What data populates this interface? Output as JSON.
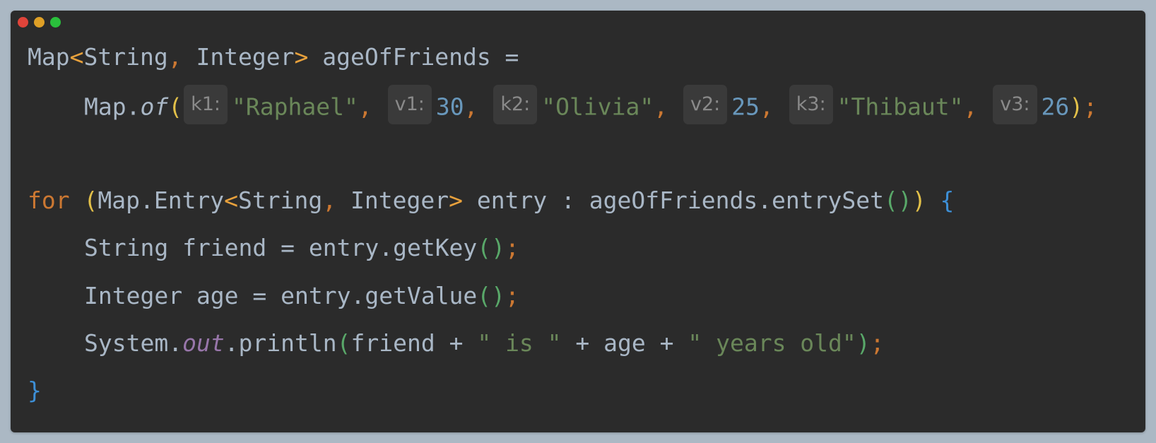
{
  "window": {
    "controls": [
      {
        "name": "close",
        "color": "#e0443a"
      },
      {
        "name": "minimize",
        "color": "#dfa026"
      },
      {
        "name": "maximize",
        "color": "#2ac03c"
      }
    ]
  },
  "code": {
    "line1": {
      "t1": "Map",
      "t2": "<",
      "t3": "String",
      "t4": ",",
      "t5": " Integer",
      "t6": ">",
      "t7": " ageOfFriends ="
    },
    "line2": {
      "t1": "Map.",
      "t2": "of",
      "t3": "(",
      "h1": "k1:",
      "s1": "\"Raphael\"",
      "c1": ", ",
      "h2": "v1:",
      "n1": "30",
      "c2": ", ",
      "h3": "k2:",
      "s2": "\"Olivia\"",
      "c3": ", ",
      "h4": "v2:",
      "n2": "25",
      "c4": ", ",
      "h5": "k3:",
      "s3": "\"Thibaut\"",
      "c5": ", ",
      "h6": "v3:",
      "n3": "26",
      "t4": ")",
      "t5": ";"
    },
    "line3": {
      "t1": "for",
      "t2": " ",
      "t3": "(",
      "t4": "Map.Entry",
      "t5": "<",
      "t6": "String",
      "t7": ",",
      "t8": " Integer",
      "t9": ">",
      "t10": " entry : ageOfFriends.entrySet",
      "t11": "()",
      "t12": ")",
      "t13": " ",
      "t14": "{"
    },
    "line4": {
      "t1": "String friend = entry.getKey",
      "t2": "()",
      "t3": ";"
    },
    "line5": {
      "t1": "Integer age = entry.getValue",
      "t2": "()",
      "t3": ";"
    },
    "line6": {
      "t1": "System.",
      "t2": "out",
      "t3": ".println",
      "t4": "(",
      "t5": "friend + ",
      "t6": "\" is \"",
      "t7": " + age + ",
      "t8": "\" years old\"",
      "t9": ")",
      "t10": ";"
    },
    "line7": {
      "t1": "}"
    }
  }
}
